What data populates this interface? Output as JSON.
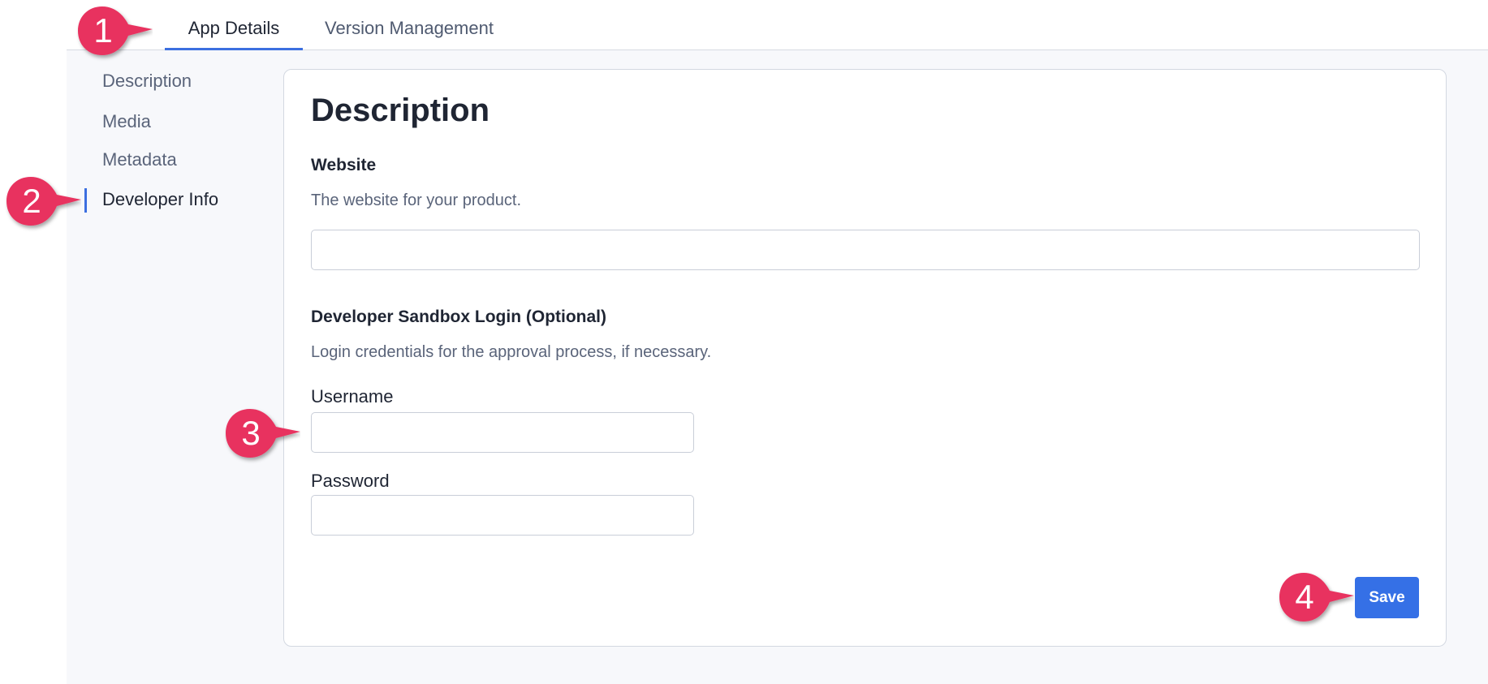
{
  "tabs": [
    {
      "label": "App Details"
    },
    {
      "label": "Version Management"
    }
  ],
  "side_nav": {
    "items": [
      {
        "label": "Description"
      },
      {
        "label": "Media"
      },
      {
        "label": "Metadata"
      },
      {
        "label": "Developer Info"
      }
    ]
  },
  "main": {
    "title": "Description",
    "website": {
      "label": "Website",
      "help": "The website for your product.",
      "value": ""
    },
    "sandbox": {
      "label": "Developer Sandbox Login (Optional)",
      "help": "Login credentials for the approval process, if necessary.",
      "username_label": "Username",
      "username_value": "",
      "password_label": "Password",
      "password_value": ""
    },
    "save_label": "Save"
  },
  "callouts": [
    {
      "number": "1"
    },
    {
      "number": "2"
    },
    {
      "number": "3"
    },
    {
      "number": "4"
    }
  ],
  "colors": {
    "accent": "#3570e6",
    "callout": "#e8335f"
  }
}
